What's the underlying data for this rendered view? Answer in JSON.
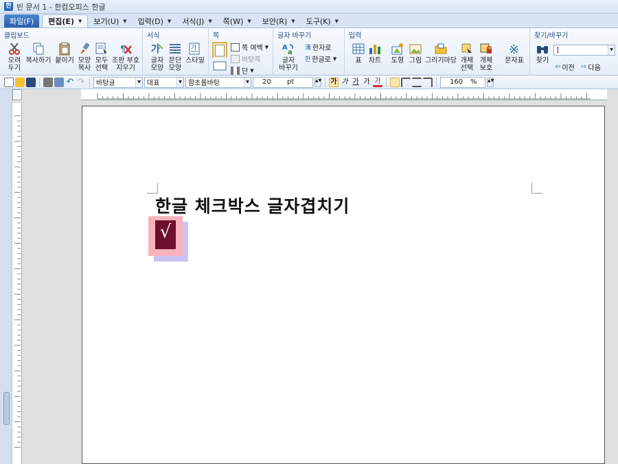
{
  "window": {
    "title": "빈 문서 1 - 한컴오피스 한글"
  },
  "menu": {
    "file": "파일(F)",
    "tabs": [
      "편집(E)",
      "보기(U)",
      "입력(D)",
      "서식(J)",
      "쪽(W)",
      "보안(R)",
      "도구(K)"
    ]
  },
  "ribbon": {
    "clipboard": {
      "title": "클립보드",
      "cut": "오려\n두기",
      "copy": "복사하기",
      "paste": "붙이기",
      "format_copy": "모양\n복사",
      "select_all": "모두\n선택",
      "clear": "조판 부호\n지우기"
    },
    "format": {
      "title": "서식",
      "char_shape": "글자\n모양",
      "para_shape": "문단\n모양",
      "style": "스타일"
    },
    "page": {
      "title": "쪽",
      "margin": "쪽 여백",
      "background": "바탕쪽",
      "column": "단"
    },
    "convert": {
      "title": "글자 바꾸기",
      "to_hanja": "한자로",
      "to_hangul": "한글로",
      "char_convert": "글자\n바꾸기"
    },
    "insert": {
      "title": "입력",
      "table": "표",
      "chart": "차트",
      "shape": "도형",
      "picture": "그림",
      "gallery": "그리기마당",
      "object_select": "개체\n선택",
      "object_protect": "개체\n보호",
      "char_map": "문자표"
    },
    "find": {
      "title": "찾기/바꾸기",
      "find": "찾기",
      "search_value": "]",
      "prev": "이전",
      "next": "다음"
    }
  },
  "format_toolbar": {
    "style": "바탕글",
    "lang": "대표",
    "font": "함초롬바탕",
    "size": "20",
    "size_unit": "pt",
    "zoom": "160",
    "zoom_unit": "%"
  },
  "document": {
    "title": "한글 체크박스 글자겹치기",
    "check_glyph": "√"
  },
  "colors": {
    "accent": "#2b5fad",
    "overlap_front": "#f6b3bd",
    "overlap_back": "#c9c4f5",
    "check_box": "#6e0f2c"
  }
}
